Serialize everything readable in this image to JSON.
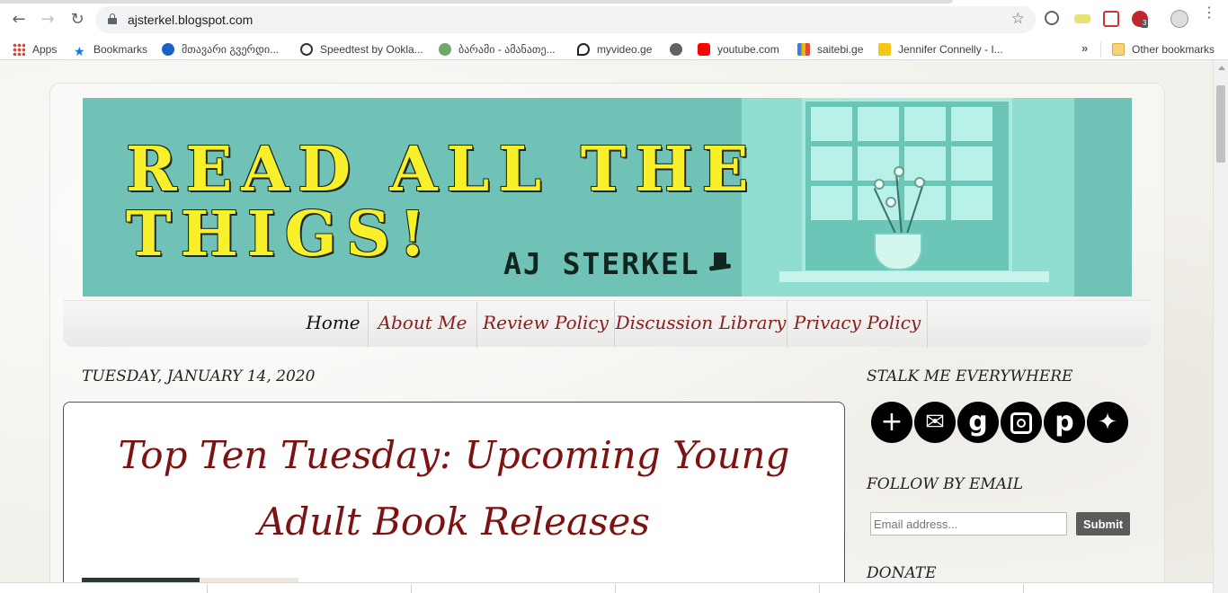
{
  "browser": {
    "url": "ajsterkel.blogspot.com",
    "bookmarks": [
      {
        "label": "Apps",
        "icon": "apps-icon"
      },
      {
        "label": "Bookmarks",
        "icon": "star-icon"
      },
      {
        "label": "მთავარი გვერდი...",
        "icon": "net-icon"
      },
      {
        "label": "Speedtest by Ookla...",
        "icon": "speedtest-icon"
      },
      {
        "label": "ბარამი - ამანათე...",
        "icon": "globe-icon"
      },
      {
        "label": "myvideo.ge",
        "icon": "myvideo-icon"
      },
      {
        "label": "youtube.com",
        "icon": "youtube-icon"
      },
      {
        "label": "saitebi.ge",
        "icon": "saitebi-icon"
      },
      {
        "label": "Jennifer Connelly - I...",
        "icon": "imdb-icon"
      }
    ],
    "other_bookmarks": "Other bookmarks",
    "extension_badge": "3"
  },
  "banner": {
    "line1": "READ ALL THE",
    "line2": "THIGS!",
    "author": "AJ STERKEL"
  },
  "nav": {
    "items": [
      "Home",
      "About Me",
      "Review Policy",
      "Discussion Library",
      "Privacy Policy"
    ]
  },
  "post": {
    "date": "TUESDAY, JANUARY 14, 2020",
    "title": "Top Ten Tuesday: Upcoming Young Adult Book Releases"
  },
  "sidebar": {
    "stalk_heading": "STALK ME EVERYWHERE",
    "follow_heading": "FOLLOW BY EMAIL",
    "email_placeholder": "Email address...",
    "submit_label": "Submit",
    "donate_heading": "DONATE"
  },
  "colors": {
    "banner_bg": "#6fc2b5",
    "title_yellow": "#f7f02a",
    "accent_red": "#8a1c1c"
  }
}
